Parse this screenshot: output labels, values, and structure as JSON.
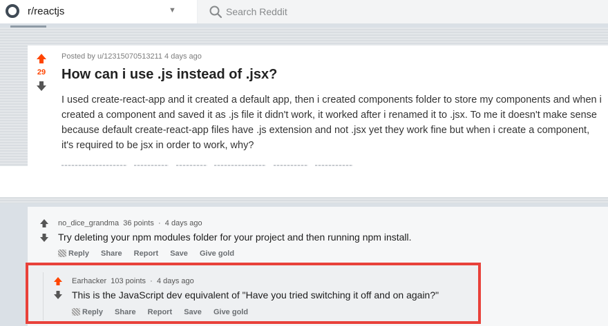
{
  "header": {
    "community": "r/reactjs",
    "search_placeholder": "Search Reddit"
  },
  "post": {
    "score": "29",
    "posted_by": "Posted by u/12315070513211 4 days ago",
    "title": "How can i use .js instead of .jsx?",
    "body": "I used create-react-app and it created a default app, then i created components folder to store my components and when i created a component and saved it as .js file it didn't work, it worked after i renamed it to .jsx. To me it doesn't make sense because default create-react-app files have .js extension and not .jsx yet they work fine but when i create a component, it's required to be jsx in order to work, why?"
  },
  "comments": [
    {
      "author": "no_dice_grandma",
      "points": "36 points",
      "separator": "·",
      "time": "4 days ago",
      "text": "Try deleting your npm modules folder for your project and then running npm install.",
      "actions": [
        "Reply",
        "Share",
        "Report",
        "Save",
        "Give gold"
      ]
    },
    {
      "author": "Earhacker",
      "points": "103 points",
      "separator": "·",
      "time": "4 days ago",
      "text": "This is the JavaScript dev equivalent of \"Have you tried switching it off and on again?\"",
      "actions": [
        "Reply",
        "Share",
        "Report",
        "Save",
        "Give gold"
      ]
    }
  ],
  "colors": {
    "upvote": "#ff4500",
    "highlight_border": "#e8413a"
  }
}
